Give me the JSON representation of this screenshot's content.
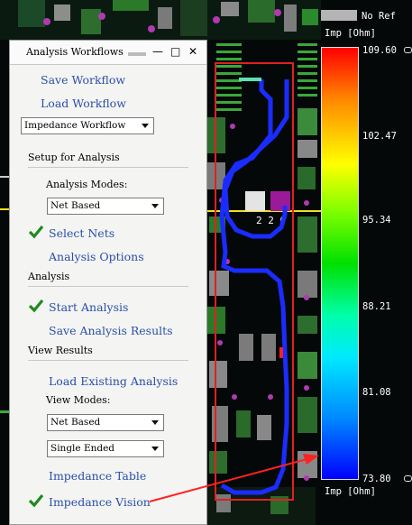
{
  "panel": {
    "title": "Analysis Workflows",
    "controls": {
      "minimize": "—",
      "maximize": "□",
      "close": "✕"
    },
    "save_workflow": "Save Workflow",
    "load_workflow": "Load Workflow",
    "workflow_select": "Impedance Workflow",
    "setup_header": "Setup for Analysis",
    "analysis_modes_label": "Analysis Modes:",
    "analysis_mode_select": "Net Based",
    "select_nets": "Select Nets",
    "analysis_options": "Analysis Options",
    "analysis_header": "Analysis",
    "start_analysis": "Start Analysis",
    "save_results": "Save Analysis Results",
    "view_results_header": "View Results",
    "load_existing": "Load Existing Analysis",
    "view_modes_label": "View Modes:",
    "view_mode_select": "Net Based",
    "ended_select": "Single Ended",
    "impedance_table": "Impedance Table",
    "impedance_vision": "Impedance Vision"
  },
  "legend": {
    "no_ref": "No Ref",
    "header": "Imp [Ohm]",
    "footer": "Imp [Ohm]",
    "ticks": [
      "109.60",
      "102.47",
      "95.34",
      "88.21",
      "81.08",
      "73.80"
    ]
  },
  "pcb": {
    "label": "2 2 0"
  },
  "colors": {
    "link": "#2a4fa8",
    "check": "#1f8a1f",
    "highlight_box": "#e02020",
    "trace": "#1a2cff",
    "arrow": "#ff2222"
  }
}
